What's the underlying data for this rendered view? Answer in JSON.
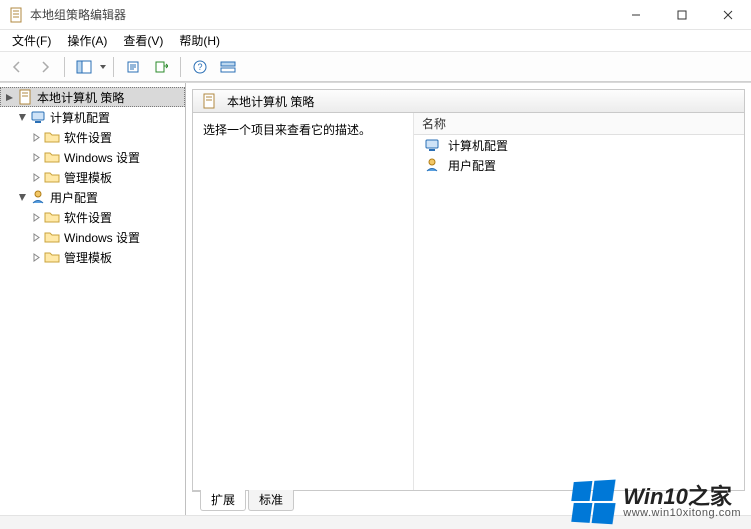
{
  "window": {
    "title": "本地组策略编辑器"
  },
  "menu": {
    "file": "文件(F)",
    "action": "操作(A)",
    "view": "查看(V)",
    "help": "帮助(H)"
  },
  "tree": {
    "root": "本地计算机 策略",
    "computer_cfg": "计算机配置",
    "user_cfg": "用户配置",
    "software_settings": "软件设置",
    "windows_settings": "Windows 设置",
    "admin_templates": "管理模板"
  },
  "content": {
    "header": "本地计算机 策略",
    "description_prompt": "选择一个项目来查看它的描述。",
    "column_name": "名称",
    "items": [
      "计算机配置",
      "用户配置"
    ]
  },
  "tabs": {
    "extended": "扩展",
    "standard": "标准"
  },
  "watermark": {
    "brand_prefix": "Win10",
    "brand_suffix": "之家",
    "url": "www.win10xitong.com"
  }
}
